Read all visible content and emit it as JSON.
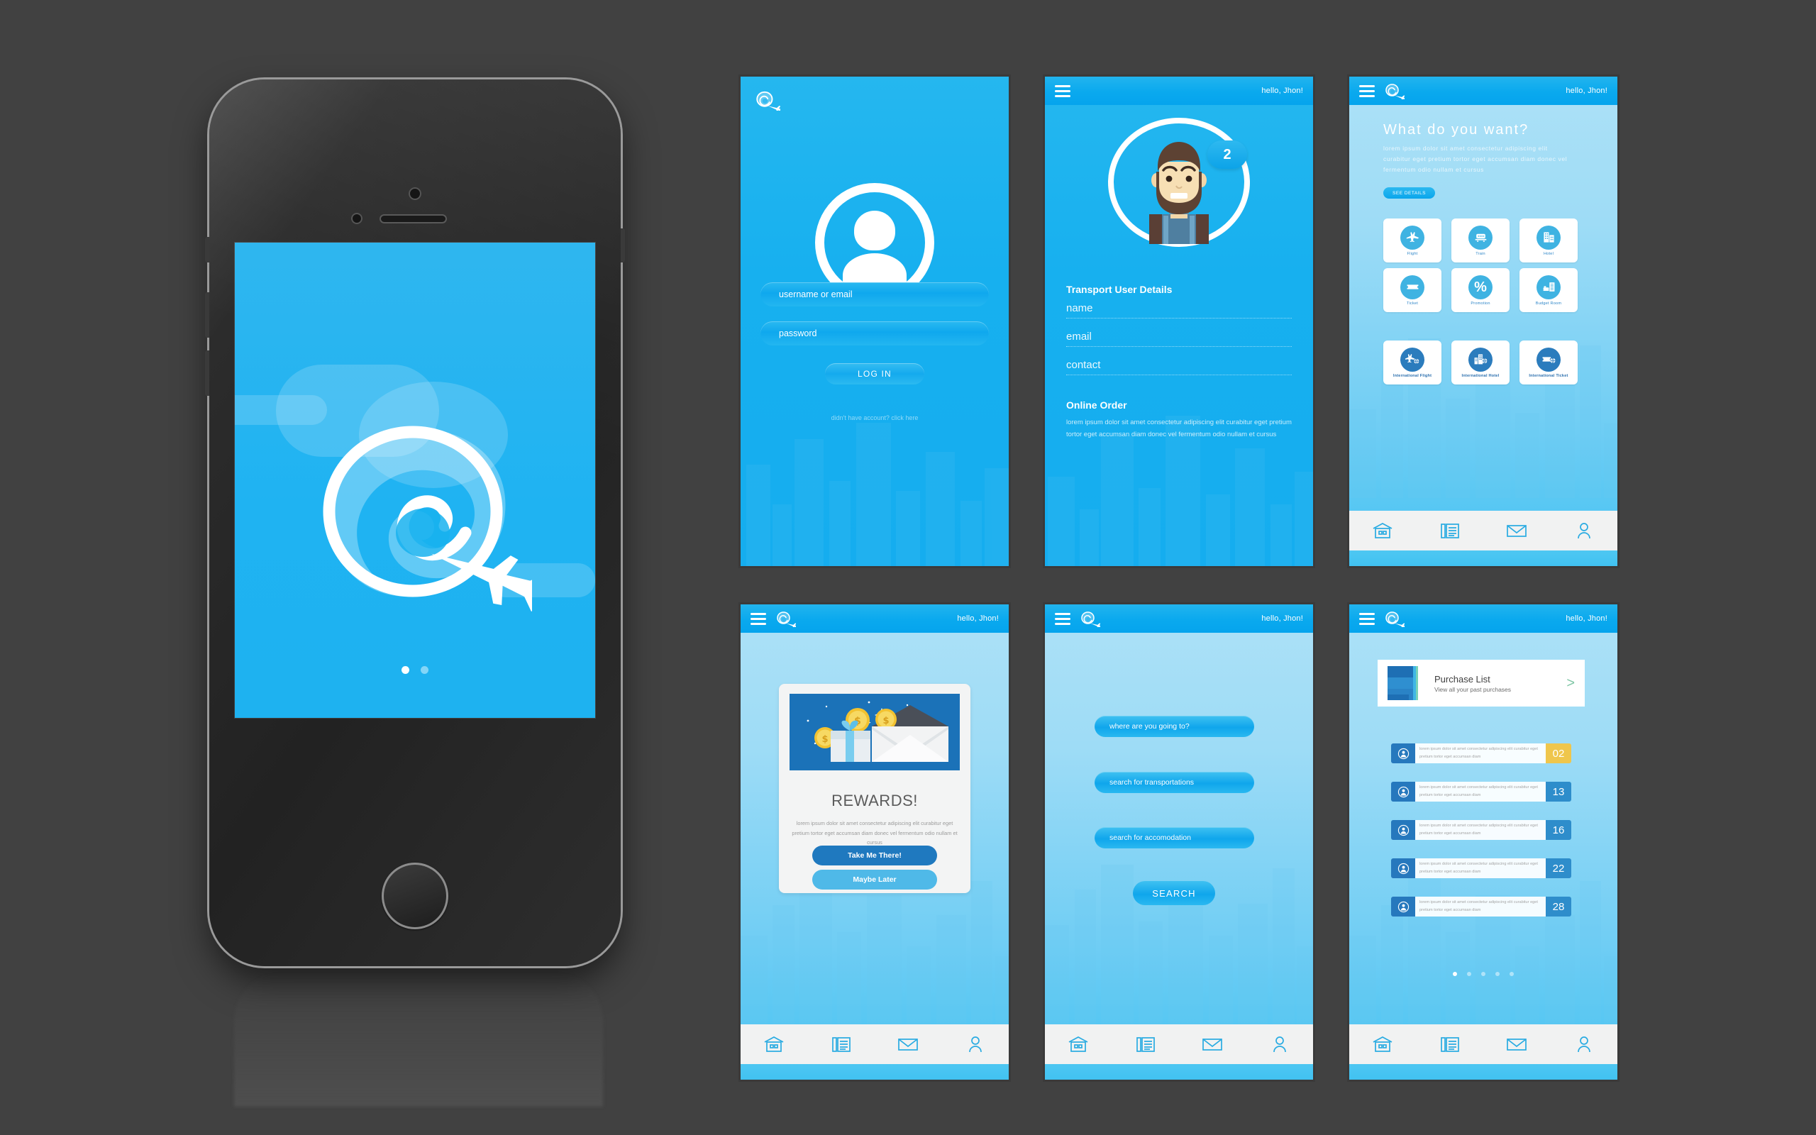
{
  "theme": {
    "page_background": "#414141",
    "brand_blue": "#16AEEF",
    "light_blue": "#ADE1F7",
    "deep_blue": "#1F79BF",
    "accent_yellow": "#EFC64C",
    "panel_white": "#FFFFFF",
    "nav_bar_grey": "#F1F2F2"
  },
  "phone": {
    "device_name": "smartphone-mockup",
    "splash": {
      "logo_name": "travel-swirl-plane-logo",
      "page_dots": [
        "active",
        "inactive"
      ]
    },
    "home_button_label": "home-button"
  },
  "screens": [
    {
      "id": "login",
      "name": "login-screen",
      "logo_name": "travel-swirl-plane-logo",
      "avatar_name": "generic-user-avatar",
      "fields": [
        {
          "name": "username-field",
          "placeholder": "username or email",
          "value": ""
        },
        {
          "name": "password-field",
          "placeholder": "password",
          "value": ""
        }
      ],
      "login_button": "LOG IN",
      "signup_link": "didn't have account? click here"
    },
    {
      "id": "profile",
      "name": "profile-screen",
      "appbar": {
        "menu": "menu-icon",
        "greeting": "hello, Jhon!"
      },
      "avatar_name": "bearded-man-avatar",
      "notification_badge": "2",
      "section_title": "Transport User Details",
      "fields": [
        {
          "name": "name-field",
          "placeholder": "name",
          "value": ""
        },
        {
          "name": "email-field",
          "placeholder": "email",
          "value": ""
        },
        {
          "name": "contact-field",
          "placeholder": "contact",
          "value": ""
        }
      ],
      "order_title": "Online Order",
      "order_text": "lorem ipsum dolor sit amet consectetur adipiscing elit curabitur eget pretium tortor eget accumsan diam donec vel fermentum odio nullam et cursus"
    },
    {
      "id": "home",
      "name": "category-home-screen",
      "appbar": {
        "menu": "menu-icon",
        "logo": "travel-swirl-plane-logo",
        "greeting": "hello, Jhon!"
      },
      "title": "What do you want?",
      "subtitle": "lorem ipsum dolor sit amet consectetur adipiscing elit curabitur eget pretium tortor eget accumsan diam donec vel fermentum odio nullam et cursus",
      "cta": "SEE DETAILS",
      "tiles": [
        {
          "label": "Flight",
          "icon": "airplane-icon",
          "style": "light"
        },
        {
          "label": "Train",
          "icon": "train-icon",
          "style": "light"
        },
        {
          "label": "Hotel",
          "icon": "building-icon",
          "style": "light"
        },
        {
          "label": "Ticket",
          "icon": "ticket-icon",
          "style": "light"
        },
        {
          "label": "Promotion",
          "icon": "percent-icon",
          "style": "light"
        },
        {
          "label": "Budget Room",
          "icon": "bed-document-icon",
          "style": "light"
        },
        {
          "label": "International Flight",
          "icon": "airplane-globe-icon",
          "style": "dark"
        },
        {
          "label": "International Hotel",
          "icon": "building-globe-icon",
          "style": "dark"
        },
        {
          "label": "International Ticket",
          "icon": "ticket-globe-icon",
          "style": "dark"
        }
      ]
    },
    {
      "id": "rewards",
      "name": "rewards-screen",
      "appbar": {
        "menu": "menu-icon",
        "logo": "travel-swirl-plane-logo",
        "greeting": "hello, Jhon!"
      },
      "illustration": "gift-coins-envelope-illustration",
      "heading": "REWARDS!",
      "body": "lorem ipsum dolor sit amet consectetur adipiscing elit curabitur eget pretium tortor eget accumsan diam donec vel fermentum odio nullam et cursus",
      "primary_button": "Take Me There!",
      "secondary_button": "Maybe Later"
    },
    {
      "id": "search",
      "name": "search-screen",
      "appbar": {
        "menu": "menu-icon",
        "logo": "travel-swirl-plane-logo",
        "greeting": "hello, Jhon!"
      },
      "fields": [
        {
          "name": "destination-field",
          "placeholder": "where are you going to?",
          "value": ""
        },
        {
          "name": "transportation-field",
          "placeholder": "search for transportations",
          "value": ""
        },
        {
          "name": "accomodation-field",
          "placeholder": "search for accomodation",
          "value": ""
        }
      ],
      "search_button": "SEARCH"
    },
    {
      "id": "purchase",
      "name": "purchase-list-screen",
      "appbar": {
        "menu": "menu-icon",
        "logo": "travel-swirl-plane-logo",
        "greeting": "hello, Jhon!"
      },
      "header_card": {
        "icon": "notebook-icon",
        "title": "Purchase List",
        "subtitle": "View all your past purchases",
        "arrow": ">"
      },
      "row_text": "lorem ipsum dolor sit amet consectetur adipiscing elit curabitur eget pretium tortor eget accumsan diam",
      "rows": [
        {
          "number": "02",
          "highlight": true
        },
        {
          "number": "13",
          "highlight": false
        },
        {
          "number": "16",
          "highlight": false
        },
        {
          "number": "22",
          "highlight": false
        },
        {
          "number": "28",
          "highlight": false
        }
      ],
      "pager_dots": [
        "active",
        "inactive",
        "inactive",
        "inactive",
        "inactive"
      ]
    }
  ],
  "bottom_nav": [
    {
      "name": "store-icon",
      "label": "store"
    },
    {
      "name": "newspaper-icon",
      "label": "news"
    },
    {
      "name": "envelope-icon",
      "label": "messages"
    },
    {
      "name": "person-icon",
      "label": "profile"
    }
  ]
}
